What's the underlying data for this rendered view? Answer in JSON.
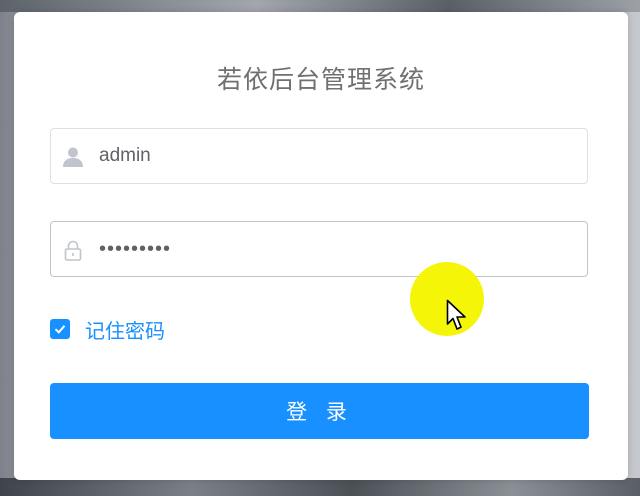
{
  "page": {
    "title": "若依后台管理系统"
  },
  "form": {
    "username": {
      "value": "admin",
      "icon": "user-icon"
    },
    "password": {
      "value": "123456789",
      "icon": "lock-icon"
    },
    "remember": {
      "label": "记住密码",
      "checked": true
    },
    "submit_label": "登 录"
  },
  "colors": {
    "primary": "#1890ff",
    "title_text": "#707070",
    "cursor_highlight": "#f5f500"
  }
}
